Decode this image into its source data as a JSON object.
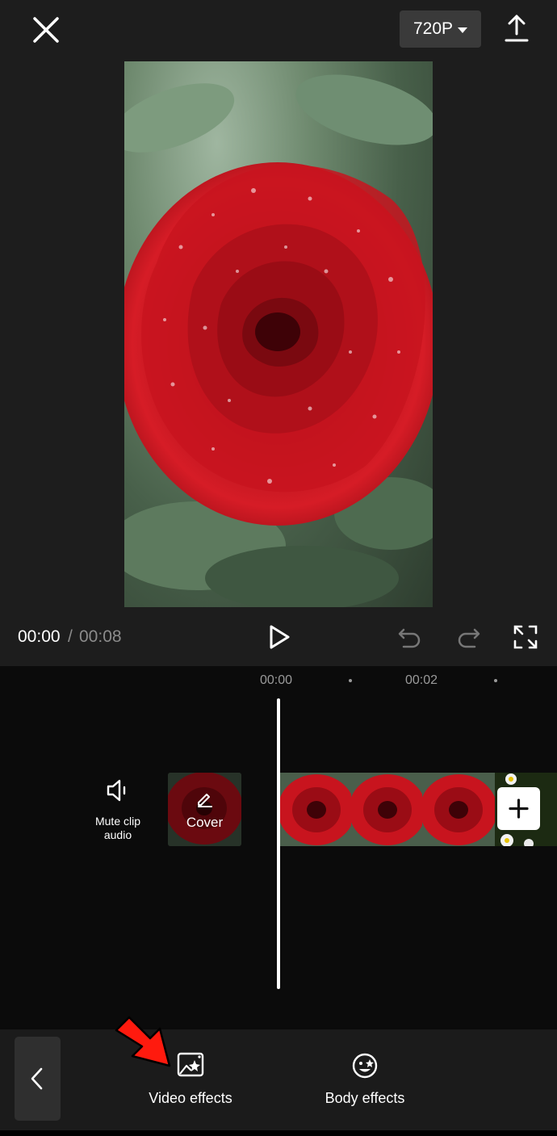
{
  "header": {
    "resolution_label": "720P",
    "close_icon": "close-icon",
    "export_icon": "export-upload-icon"
  },
  "player": {
    "current_time": "00:00",
    "separator": "/",
    "total_time": "00:08"
  },
  "timeline": {
    "ticks": [
      "00:00",
      "00:02"
    ],
    "mute_label_line1": "Mute clip",
    "mute_label_line2": "audio",
    "cover_label": "Cover",
    "clip_frames": 3
  },
  "toolbar": {
    "items": [
      {
        "label": "Video effects",
        "icon": "video-effects-icon"
      },
      {
        "label": "Body effects",
        "icon": "body-effects-icon"
      }
    ]
  },
  "colors": {
    "annotation_arrow": "#ff1a0e",
    "rose_red": "#c8141e",
    "toolbar_bg": "#1b1b1b",
    "preview_bg": "#1d1d1d"
  }
}
